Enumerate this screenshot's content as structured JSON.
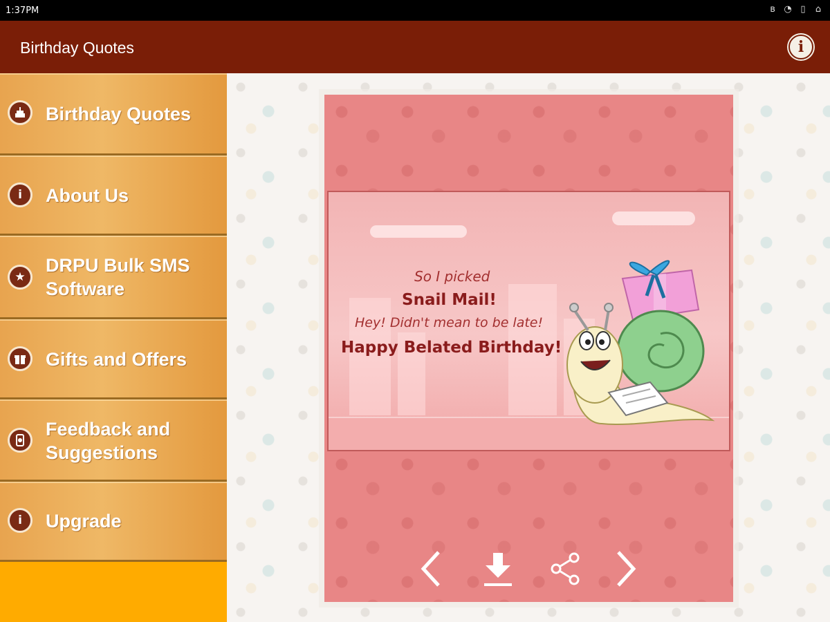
{
  "status_bar": {
    "time": "1:37PM",
    "icons": [
      "bluetooth-icon",
      "alarm-icon",
      "battery-icon",
      "lock-icon"
    ]
  },
  "app_bar": {
    "title": "Birthday Quotes",
    "info_icon": "info-icon"
  },
  "drawer": {
    "items": [
      {
        "label": "Birthday Quotes",
        "icon": "cake-icon"
      },
      {
        "label": "About Us",
        "icon": "info-icon"
      },
      {
        "label": "DRPU Bulk SMS Software",
        "icon": "star-icon"
      },
      {
        "label": "Gifts and Offers",
        "icon": "gift-icon"
      },
      {
        "label": "Feedback and Suggestions",
        "icon": "feedback-icon"
      },
      {
        "label": "Upgrade",
        "icon": "info-icon"
      }
    ]
  },
  "card": {
    "lines": [
      "So I picked",
      "Snail Mail!",
      "Hey! Didn't mean to be late!",
      "Happy Belated Birthday!"
    ],
    "controls": [
      "previous-icon",
      "download-icon",
      "share-icon",
      "next-icon"
    ]
  },
  "colors": {
    "app_bar": "#7a1e07",
    "drawer_accent": "#ffab00",
    "card_background": "#e88686",
    "greeting_text": "#8a1c1c"
  }
}
